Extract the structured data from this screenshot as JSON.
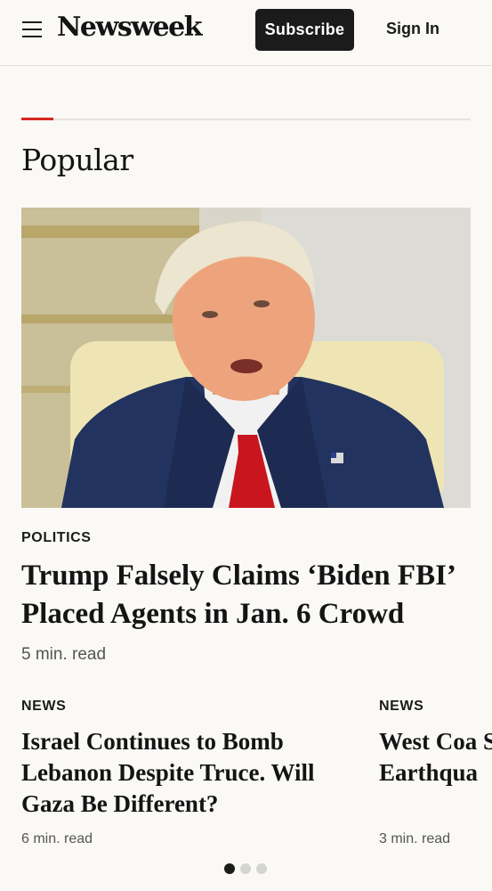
{
  "header": {
    "logo": "Newsweek",
    "subscribe_label": "Subscribe",
    "signin_label": "Sign In"
  },
  "section": {
    "title": "Popular"
  },
  "featured": {
    "category": "POLITICS",
    "headline": "Trump Falsely Claims ‘Biden FBI’ Placed Agents in Jan. 6 Crowd",
    "read_time": "5 min. read"
  },
  "carousel": [
    {
      "category": "NEWS",
      "headline": "Israel Continues to Bomb Lebanon Despite Truce. Will Gaza Be Different?",
      "read_time": "6 min. read"
    },
    {
      "category": "NEWS",
      "headline": "West Coa Scenario Earthqua",
      "read_time": "3 min. read"
    }
  ],
  "pagination": {
    "total": 3,
    "active_index": 0
  },
  "colors": {
    "accent": "#d7271d",
    "button_bg": "#1b1b1b",
    "background": "#faf9f6"
  }
}
